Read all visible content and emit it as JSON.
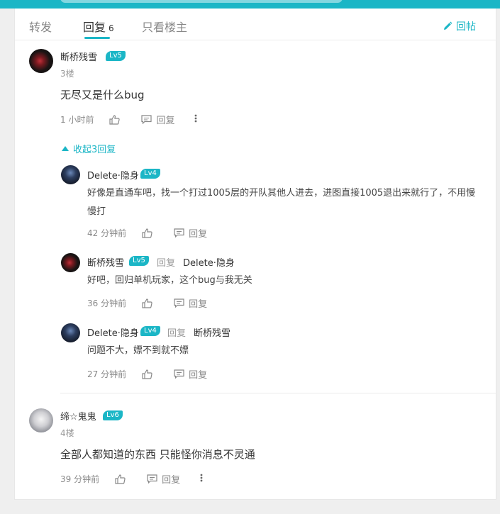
{
  "tabs": [
    {
      "label": "转发"
    },
    {
      "label": "回复",
      "count": "6"
    },
    {
      "label": "只看楼主"
    }
  ],
  "reply_post_label": "回帖",
  "comments": [
    {
      "user": "断桥残雪",
      "level": "Lv5",
      "floor": "3楼",
      "text": "无尽又是什么bug",
      "time": "1 小时前",
      "reply_label": "回复",
      "collapse_label": "收起3回复",
      "replies": [
        {
          "user": "Delete·隐身",
          "level": "Lv4",
          "text": "好像是直通车吧，找一个打过1005层的开队其他人进去，进图直接1005退出来就行了，不用慢慢打",
          "time": "42 分钟前",
          "reply_label": "回复"
        },
        {
          "user": "断桥残雪",
          "level": "Lv5",
          "reply_word": "回复",
          "target": "Delete·隐身",
          "text": "好吧，回归单机玩家，这个bug与我无关",
          "time": "36 分钟前",
          "reply_label": "回复"
        },
        {
          "user": "Delete·隐身",
          "level": "Lv4",
          "reply_word": "回复",
          "target": "断桥残雪",
          "text": "问题不大，嫖不到就不嫖",
          "time": "27 分钟前",
          "reply_label": "回复"
        }
      ]
    },
    {
      "user": "缔☆鬼鬼",
      "level": "Lv6",
      "floor": "4楼",
      "text": "全部人都知道的东西 只能怪你消息不灵通",
      "time": "39 分钟前",
      "reply_label": "回复"
    }
  ],
  "colors": {
    "accent": "#1bb6c6"
  }
}
